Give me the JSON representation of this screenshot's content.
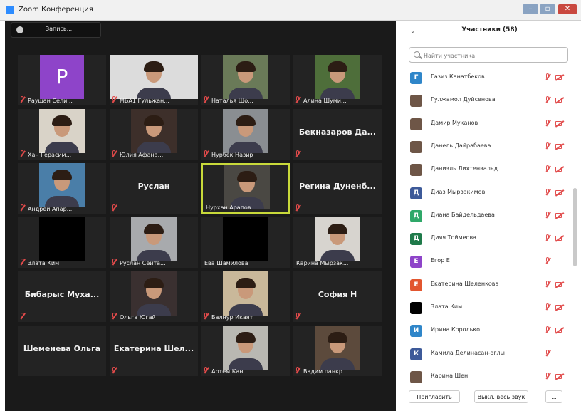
{
  "window": {
    "title": "Zoom Конференция"
  },
  "recording": {
    "label": "Запись..."
  },
  "tiles": [
    {
      "name": "Раушан Сели...",
      "kind": "avatar",
      "avatar_letter": "P",
      "avatar_color": "#8e44c9",
      "muted": true
    },
    {
      "name": "МБА1 Гульжан...",
      "kind": "photo",
      "bg": "#dcdcdc",
      "muted": true
    },
    {
      "name": "Наталья Шо...",
      "kind": "photo",
      "bg": "#6a7a58",
      "muted": true
    },
    {
      "name": "Алина Шуми...",
      "kind": "photo",
      "bg": "#4e6e3a",
      "muted": true
    },
    {
      "name": "Хан Герасим...",
      "kind": "photo",
      "bg": "#d9d3c8",
      "muted": true
    },
    {
      "name": "Юлия Афана...",
      "kind": "photo",
      "bg": "#3d2f2a",
      "muted": true
    },
    {
      "name": "Нурбек Назир",
      "kind": "photo",
      "bg": "#8a8e92",
      "muted": true
    },
    {
      "name": "Бекназаров Да...",
      "kind": "text",
      "muted": true
    },
    {
      "name": "Андрей Апар...",
      "kind": "photo",
      "bg": "#4a7ea8",
      "muted": true
    },
    {
      "name": "Руслан",
      "kind": "text",
      "muted": true
    },
    {
      "name": "Нурхан Арапов",
      "kind": "photo",
      "bg": "#4a4843",
      "muted": false,
      "active": true
    },
    {
      "name": "Регина Дуненб...",
      "kind": "text",
      "muted": true
    },
    {
      "name": "Злата Ким",
      "kind": "blank",
      "muted": true
    },
    {
      "name": "Руслан Сейта...",
      "kind": "photo",
      "bg": "#a8aaad",
      "muted": true
    },
    {
      "name": "Ева Шамилова",
      "kind": "blank",
      "muted": false
    },
    {
      "name": "Карина Мырзак...",
      "kind": "photo",
      "bg": "#d7d4cf",
      "muted": false
    },
    {
      "name": "Бибарыс Муха...",
      "kind": "text",
      "muted": true
    },
    {
      "name": "Ольга Югай",
      "kind": "photo",
      "bg": "#3a3030",
      "muted": true
    },
    {
      "name": "Балнур Икаят",
      "kind": "photo",
      "bg": "#c9b89a",
      "muted": true
    },
    {
      "name": "София Н",
      "kind": "text",
      "muted": true
    },
    {
      "name": "Шеменева Ольга",
      "kind": "text",
      "muted": false
    },
    {
      "name": "Екатерина Шел...",
      "kind": "text",
      "muted": true
    },
    {
      "name": "Артем Кан",
      "kind": "photo",
      "bg": "#b9b8b2",
      "muted": true
    },
    {
      "name": "Вадим панкр...",
      "kind": "photo",
      "bg": "#5c4a3c",
      "muted": true
    }
  ],
  "participants": {
    "header": "Участники (58)",
    "search_placeholder": "Найти участника",
    "list": [
      {
        "name": "Газиз Канатбеков",
        "initial": "Г",
        "color": "#2f86c9",
        "photo": false,
        "cam": true
      },
      {
        "name": "Гулжамол Дуйсенова",
        "initial": "",
        "color": "",
        "photo": true,
        "cam": true
      },
      {
        "name": "Дамир Муканов",
        "initial": "",
        "color": "",
        "photo": true,
        "cam": true
      },
      {
        "name": "Данель Дайрабаева",
        "initial": "",
        "color": "",
        "photo": true,
        "cam": true
      },
      {
        "name": "Даниэль Лихтенвальд",
        "initial": "",
        "color": "",
        "photo": true,
        "cam": true
      },
      {
        "name": "Диаз Мырзакимов",
        "initial": "Д",
        "color": "#3d5a99",
        "photo": false,
        "cam": true
      },
      {
        "name": "Диана Байдельдаева",
        "initial": "Д",
        "color": "#2fa869",
        "photo": false,
        "cam": true
      },
      {
        "name": "Дияя Тоймеова",
        "initial": "Д",
        "color": "#1f7a4a",
        "photo": false,
        "cam": true
      },
      {
        "name": "Егор Е",
        "initial": "Е",
        "color": "#8e44c9",
        "photo": false,
        "cam": false
      },
      {
        "name": "Екатерина Шеленкова",
        "initial": "Е",
        "color": "#e2562f",
        "photo": false,
        "cam": true
      },
      {
        "name": "Злата Ким",
        "initial": "",
        "color": "#000000",
        "photo": false,
        "cam": true
      },
      {
        "name": "Ирина Королько",
        "initial": "И",
        "color": "#2f86c9",
        "photo": false,
        "cam": true
      },
      {
        "name": "Камила Делинасан-оглы",
        "initial": "К",
        "color": "#3d5a99",
        "photo": false,
        "cam": false
      },
      {
        "name": "Карина Шен",
        "initial": "",
        "color": "",
        "photo": true,
        "cam": true
      }
    ],
    "invite_label": "Пригласить",
    "mute_all_label": "Выкл. весь звук",
    "more_label": "..."
  }
}
